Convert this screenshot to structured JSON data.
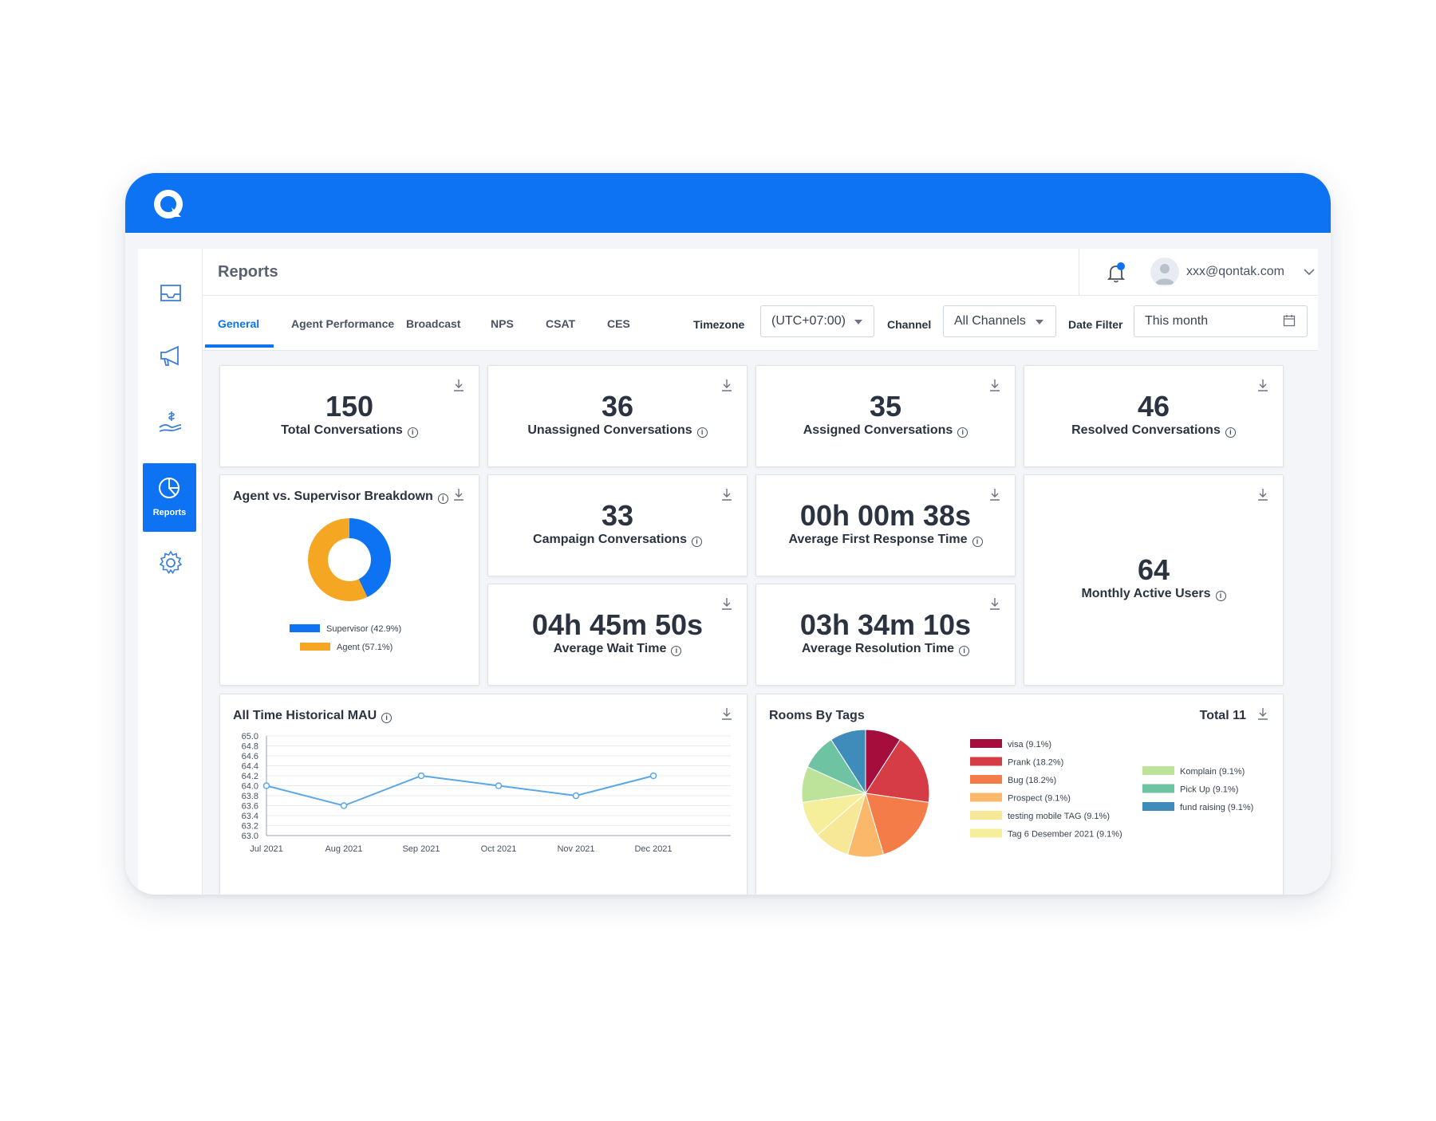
{
  "header": {
    "page_title": "Reports",
    "user_email": "xxx@qontak.com"
  },
  "sidebar": {
    "items": [
      {
        "name": "inbox-icon"
      },
      {
        "name": "megaphone-icon"
      },
      {
        "name": "hand-money-icon"
      },
      {
        "name": "pie-chart-icon",
        "label": "Reports",
        "active": true
      },
      {
        "name": "gear-icon"
      }
    ]
  },
  "tabs": [
    "General",
    "Agent Performance",
    "Broadcast",
    "NPS",
    "CSAT",
    "CES"
  ],
  "filters": {
    "timezone_label": "Timezone",
    "timezone_value": "(UTC+07:00)",
    "channel_label": "Channel",
    "channel_value": "All Channels",
    "date_label": "Date Filter",
    "date_value": "This month"
  },
  "stats": {
    "total": {
      "value": "150",
      "label": "Total Conversations"
    },
    "unassigned": {
      "value": "36",
      "label": "Unassigned Conversations"
    },
    "assigned": {
      "value": "35",
      "label": "Assigned Conversations"
    },
    "resolved": {
      "value": "46",
      "label": "Resolved Conversations"
    },
    "campaign": {
      "value": "33",
      "label": "Campaign Conversations"
    },
    "first_response": {
      "value": "00h 00m 38s",
      "label": "Average First Response Time"
    },
    "monthly_active": {
      "value": "64",
      "label": "Monthly Active Users"
    },
    "wait_time": {
      "value": "04h 45m 50s",
      "label": "Average Wait Time"
    },
    "resolution_time": {
      "value": "03h 34m 10s",
      "label": "Average Resolution Time"
    }
  },
  "breakdown": {
    "title": "Agent vs. Supervisor Breakdown",
    "legend": [
      "Supervisor (42.9%)",
      "Agent (57.1%)"
    ]
  },
  "mau": {
    "title": "All Time Historical MAU"
  },
  "rooms": {
    "title": "Rooms By Tags",
    "total": "Total 11"
  },
  "colors": {
    "brand": "#0d73f2",
    "supervisor": "#0d73f2",
    "agent": "#f5a623"
  },
  "chart_data": [
    {
      "type": "pie",
      "name": "Agent vs. Supervisor Breakdown",
      "donut": true,
      "labels": [
        "Supervisor (42.9%)",
        "Agent (57.1%)"
      ],
      "values": [
        42.9,
        57.1
      ],
      "colors": [
        "#0d73f2",
        "#f5a623"
      ],
      "legend_position": "bottom"
    },
    {
      "type": "line",
      "name": "All Time Historical MAU",
      "x": [
        "Jul 2021",
        "Aug 2021",
        "Sep 2021",
        "Oct 2021",
        "Nov 2021",
        "Dec 2021"
      ],
      "values": [
        64.0,
        63.6,
        64.2,
        64.0,
        63.8,
        64.2
      ],
      "ylim": [
        63.0,
        65.0
      ],
      "yticks": [
        "65.0",
        "64.8",
        "64.6",
        "64.4",
        "64.2",
        "64.0",
        "63.8",
        "63.6",
        "63.4",
        "63.2",
        "63.0"
      ],
      "grid": true,
      "color": "#5aa7e6"
    },
    {
      "type": "pie",
      "name": "Rooms By Tags",
      "labels": [
        "visa (9.1%)",
        "Prank (18.2%)",
        "Bug (18.2%)",
        "Prospect (9.1%)",
        "testing mobile TAG (9.1%)",
        "Tag 6 Desember 2021 (9.1%)",
        "Komplain (9.1%)",
        "Pick Up (9.1%)",
        "fund raising (9.1%)"
      ],
      "values": [
        9.1,
        18.2,
        18.2,
        9.1,
        9.1,
        9.1,
        9.1,
        9.1,
        9.1
      ],
      "colors": [
        "#a50d3c",
        "#d63c45",
        "#f47c48",
        "#fbb86b",
        "#f7e898",
        "#f5ef9c",
        "#bde39a",
        "#6ec3a3",
        "#3f8cbb"
      ],
      "legend_position": "right"
    }
  ]
}
